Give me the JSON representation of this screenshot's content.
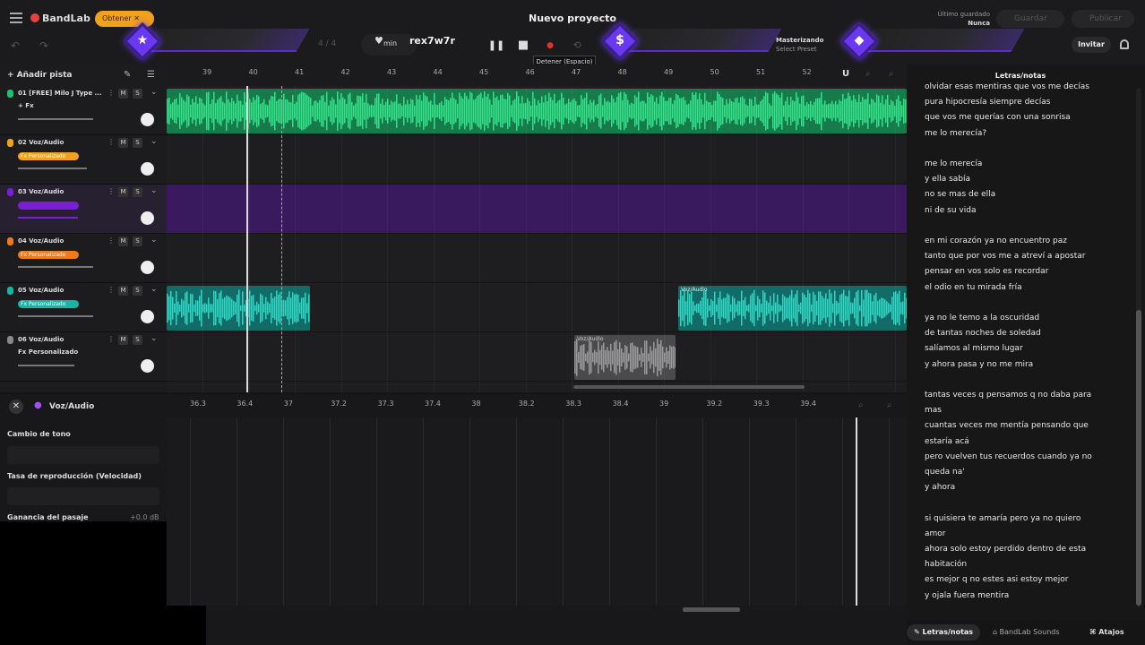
{
  "header": {
    "brand": "BandLab",
    "get_label": "Obtener",
    "project_title": "Nuevo proyecto",
    "saved_label": "Último guardado",
    "saved_value": "Nunca",
    "save_label": "Guardar",
    "publish_label": "Publicar",
    "invite_label": "Invitar",
    "time_signature": "4 / 4",
    "tempo_unit": "min",
    "key_label": "rex7w7r",
    "stop_tooltip": "Detener (Espacio)",
    "mastering_label": "Masterizando",
    "mastering_preset": "Select Preset"
  },
  "colors": {
    "accent_purple": "#6a38f0",
    "track1": "#1fbf72",
    "track3": "#7a1fd6",
    "track5": "#18b5a6",
    "gold": "#f2a21a",
    "orange": "#f07a1a"
  },
  "tracks_panel": {
    "add_track": "Añadir pista",
    "mute": "M",
    "solo": "S"
  },
  "tracks": [
    {
      "name": "01 [FREE] Milo J Type ...",
      "fx": "+ Fx",
      "color": "#1fbf72",
      "badge": "",
      "volume": 0.6
    },
    {
      "name": "02 Voz/Audio",
      "fx": "",
      "color": "#f2a21a",
      "badge": "Fx Personalizado",
      "volume": 0.55
    },
    {
      "name": "03 Voz/Audio",
      "fx": "",
      "color": "#7a1fd6",
      "badge": "",
      "volume": 0.48
    },
    {
      "name": "04 Voz/Audio",
      "fx": "",
      "color": "#f07a1a",
      "badge": "Fx Personalizado",
      "volume": 0.6
    },
    {
      "name": "05 Voz/Audio",
      "fx": "",
      "color": "#18b5a6",
      "badge": "Fx Personalizado",
      "volume": 0.6
    },
    {
      "name": "06 Voz/Audio",
      "fx": "Fx Personalizado",
      "color": "#888888",
      "badge": "",
      "volume": 0.45
    }
  ],
  "ruler": [
    "39",
    "40",
    "41",
    "42",
    "43",
    "44",
    "45",
    "46",
    "47",
    "48",
    "49",
    "50",
    "51",
    "52"
  ],
  "clips": {
    "clip5b_label": "Voz/Audio",
    "clip6_label": "Voz/Audio"
  },
  "editor": {
    "title": "Voz/Audio",
    "pitch_label": "Cambio de tono",
    "rate_label": "Tasa de reproducción (Velocidad)",
    "gain_label": "Ganancia del pasaje",
    "gain_value": "+0.0 dB",
    "ruler": [
      "36.3",
      "36.4",
      "37",
      "37.2",
      "37.3",
      "37.4",
      "38",
      "38.2",
      "38.3",
      "38.4",
      "39",
      "39.2",
      "39.3",
      "39.4"
    ]
  },
  "lyrics": {
    "header": "Letras/notas",
    "lines": [
      "olvidar esas mentiras que vos me decías",
      "pura hipocresía siempre decías",
      "que vos me querías con una sonrisa",
      "me lo merecía?",
      "",
      "me lo merecía",
      "y ella sabía",
      "no se mas de ella",
      "ni de su vida",
      "",
      "  en mi corazón ya no encuentro paz",
      "tanto que por vos me a  atreví a apostar",
      "pensar en vos solo es recordar",
      "el odio en tu mirada fría",
      "",
      "ya no le temo a la oscuridad",
      "de tantas noches de soledad",
      "salíamos al mismo lugar",
      "y ahora pasa y no me mira",
      "",
      "tantas veces q pensamos q no daba para",
      "mas",
      "cuantas  veces me mentía pensando que",
      "estaría acá",
      "pero vuelven tus recuerdos cuando ya no",
      "queda na'",
      "y ahora",
      "",
      "si quisiera te amaría pero ya no quiero",
      "amor",
      "ahora solo estoy perdido dentro de esta",
      "habitación",
      "es mejor q no estes   asi estoy mejor",
      "y ojala fuera mentira"
    ]
  },
  "bottom_tabs": {
    "lyrics": "Letras/notas",
    "sounds": "BandLab Sounds",
    "shortcuts": "Atajos"
  }
}
